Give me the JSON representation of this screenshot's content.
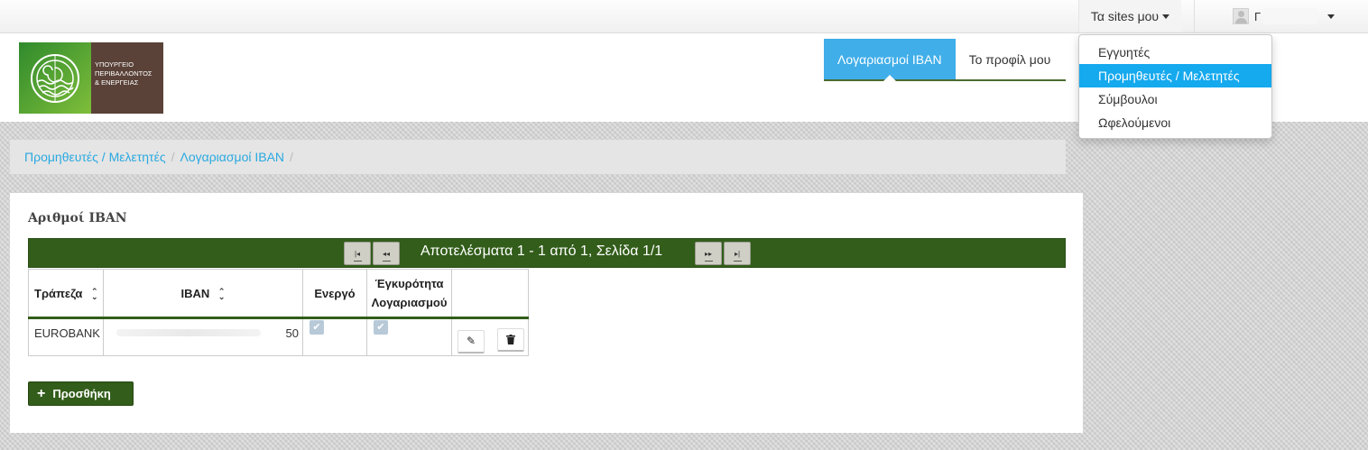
{
  "topbar": {
    "sites_label": "Τα sites μου",
    "user_name": "Γ"
  },
  "logo": {
    "line1": "ΥΠΟΥΡΓΕΙΟ",
    "line2": "ΠΕΡΙΒΑΛΛΟΝΤΟΣ",
    "line3": "& ΕΝΕΡΓΕΙΑΣ"
  },
  "nav": {
    "tabs": [
      {
        "label": "Λογαριασμοί IBAN",
        "active": true
      },
      {
        "label": "Το προφίλ μου",
        "active": false
      }
    ]
  },
  "dropdown": {
    "items": [
      {
        "label": "Εγγυητές"
      },
      {
        "label": "Προμηθευτές / Μελετητές",
        "active": true
      },
      {
        "label": "Σύμβουλοι"
      },
      {
        "label": "Ωφελούμενοι"
      }
    ]
  },
  "breadcrumb": {
    "items": [
      "Προμηθευτές / Μελετητές",
      "Λογαριασμοί IBAN"
    ],
    "separator": "/"
  },
  "panel": {
    "title": "Αριθμοί IBAN",
    "pager_text": "Αποτελέσματα 1 - 1 από 1, Σελίδα 1/1",
    "pager_buttons": {
      "first": "|◂",
      "prev": "◂◂",
      "next": "▸▸",
      "last": "▸|"
    },
    "columns": [
      "Τράπεζα",
      "IBAN",
      "Ενεργό",
      "Έγκυρότητα Λογαριασμού"
    ],
    "rows": [
      {
        "bank": "EUROBANK",
        "iban_tail": "50",
        "active": true,
        "valid": true
      }
    ],
    "add_label": "Προσθήκη"
  },
  "colors": {
    "accent_blue": "#40aee9",
    "dropdown_active": "#15a9ee",
    "dark_green": "#325d1a",
    "link": "#2aa9e0"
  }
}
